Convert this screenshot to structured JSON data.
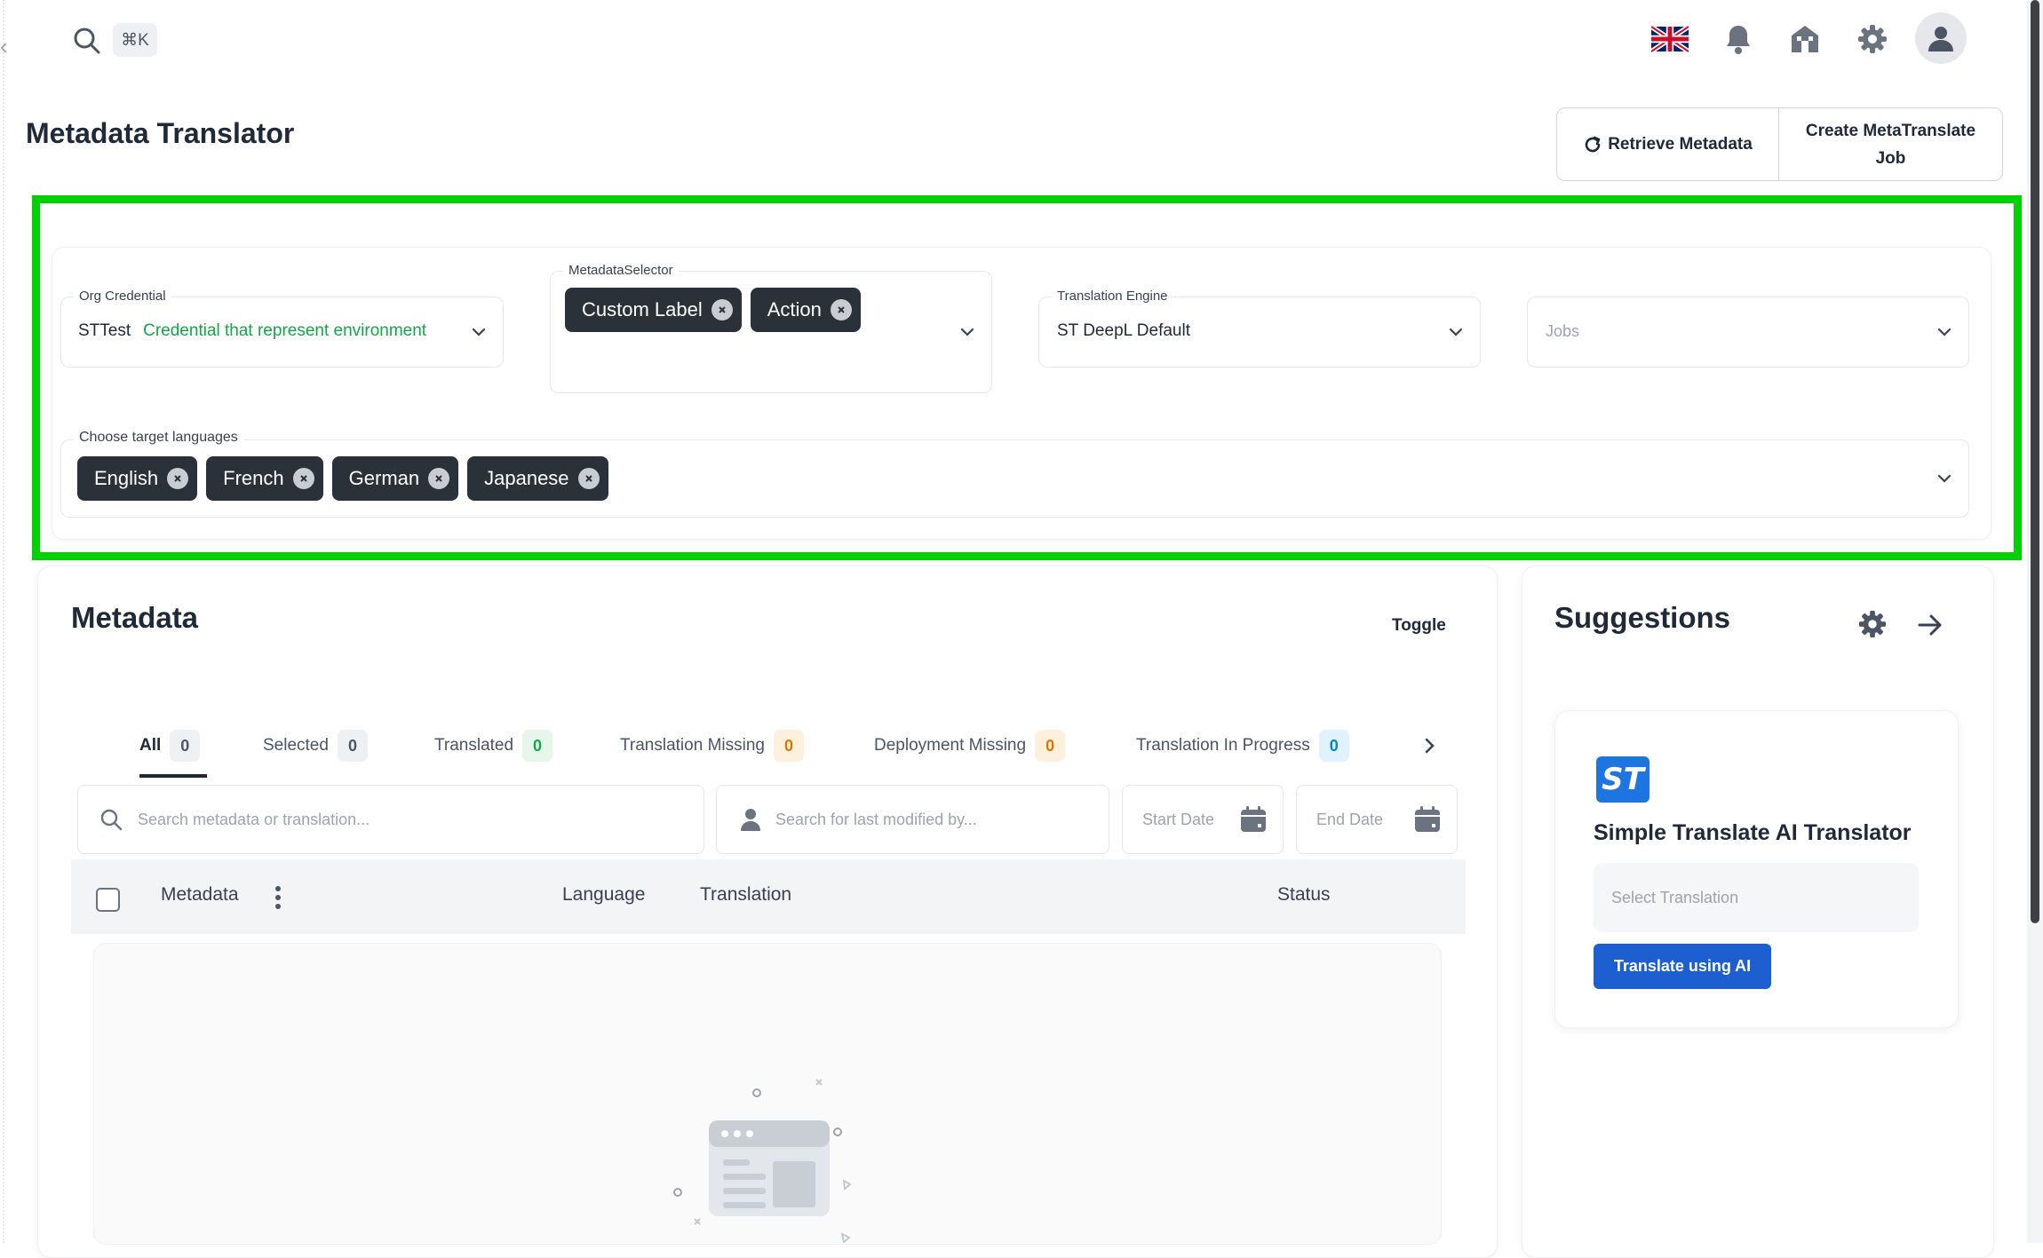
{
  "topbar": {
    "shortcut": "⌘K",
    "icons": [
      "search-icon",
      "uk-flag-icon",
      "bell-icon",
      "home-icon",
      "gear-icon",
      "user-icon"
    ]
  },
  "page": {
    "title": "Metadata Translator"
  },
  "actions": {
    "retrieve_label": "Retrieve Metadata",
    "create_label": "Create MetaTranslate Job"
  },
  "filters": {
    "org_credential": {
      "label": "Org Credential",
      "value": "STTest",
      "hint": "Credential that represent environment"
    },
    "metadata_selector": {
      "label": "MetadataSelector",
      "chips": [
        "Custom Label",
        "Action"
      ]
    },
    "translation_engine": {
      "label": "Translation Engine",
      "value": "ST DeepL Default"
    },
    "jobs": {
      "placeholder": "Jobs"
    },
    "target_languages": {
      "label": "Choose target languages",
      "chips": [
        "English",
        "French",
        "German",
        "Japanese"
      ]
    }
  },
  "metadata_panel": {
    "title": "Metadata",
    "toggle_label": "Toggle",
    "tabs": [
      {
        "label": "All",
        "count": "0"
      },
      {
        "label": "Selected",
        "count": "0"
      },
      {
        "label": "Translated",
        "count": "0"
      },
      {
        "label": "Translation Missing",
        "count": "0"
      },
      {
        "label": "Deployment Missing",
        "count": "0"
      },
      {
        "label": "Translation In Progress",
        "count": "0"
      }
    ],
    "search_placeholder": "Search metadata or translation...",
    "modified_by_placeholder": "Search for last modified by...",
    "start_date_placeholder": "Start Date",
    "end_date_placeholder": "End Date",
    "columns": [
      "Metadata",
      "Language",
      "Translation",
      "Status"
    ]
  },
  "suggestions": {
    "title": "Suggestions",
    "logo_text": "ST",
    "card_title": "Simple Translate AI Translator",
    "select_placeholder": "Select Translation",
    "button_label": "Translate using AI"
  },
  "colors": {
    "highlight": "#00d100",
    "chip": "#2a3139",
    "primary_button": "#1d5fd1",
    "credential_hint": "#16a34a"
  }
}
